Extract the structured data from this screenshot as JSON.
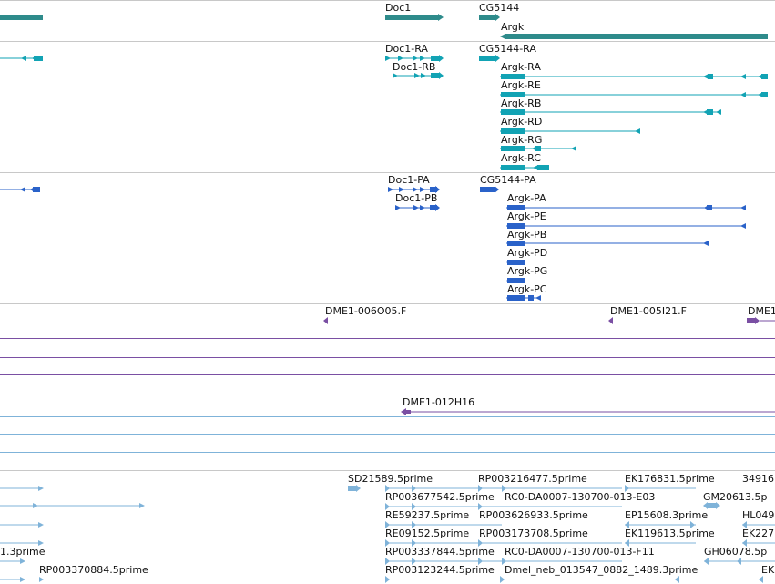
{
  "colors": {
    "gene": "#2e8b8b",
    "transcript": "#12a3b4",
    "protein": "#2a62c9",
    "bac": "#7a4fa3",
    "est": "#7fb3d9",
    "separator": "#c8c8c8"
  },
  "genes": {
    "doc1": "Doc1",
    "cg5144": "CG5144",
    "argk": "Argk"
  },
  "transcripts": {
    "doc1_ra": "Doc1-RA",
    "doc1_rb": "Doc1-RB",
    "cg5144_ra": "CG5144-RA",
    "argk_ra": "Argk-RA",
    "argk_re": "Argk-RE",
    "argk_rb": "Argk-RB",
    "argk_rd": "Argk-RD",
    "argk_rg": "Argk-RG",
    "argk_rc": "Argk-RC"
  },
  "proteins": {
    "doc1_pa": "Doc1-PA",
    "doc1_pb": "Doc1-PB",
    "cg5144_pa": "CG5144-PA",
    "argk_pa": "Argk-PA",
    "argk_pe": "Argk-PE",
    "argk_pb": "Argk-PB",
    "argk_pd": "Argk-PD",
    "argk_pg": "Argk-PG",
    "argk_pc": "Argk-PC"
  },
  "bac_clones": {
    "c1": "DME1-006O05.F",
    "c2": "DME1-005I21.F",
    "c3": "DME1",
    "c4": "DME1-012H16"
  },
  "ests": {
    "sd21589": "SD21589.5prime",
    "rp003216477": "RP003216477.5prime",
    "ek176831": "EK176831.5prime",
    "e_349": "34916",
    "rp003677542": "RP003677542.5prime",
    "rc0_e03": "RC0-DA0007-130700-013-E03",
    "gm20613": "GM20613.5p",
    "re59237": "RE59237.5prime",
    "rp003626933": "RP003626933.5prime",
    "ep15608": "EP15608.3prime",
    "hl049": "HL049",
    "re09152": "RE09152.5prime",
    "rp003173708": "RP003173708.5prime",
    "ek119613": "EK119613.5prime",
    "ek227": "EK227",
    "left_1_3": "1.3prime",
    "rp003337844": "RP003337844.5prime",
    "rc0_f11": "RC0-DA0007-130700-013-F11",
    "gh06078": "GH06078.5p",
    "rp003370884": "RP003370884.5prime",
    "rp003123244": "RP003123244.5prime",
    "dmel_neb": "Dmel_neb_013547_0882_1489.3prime",
    "ek_end": "EK"
  }
}
